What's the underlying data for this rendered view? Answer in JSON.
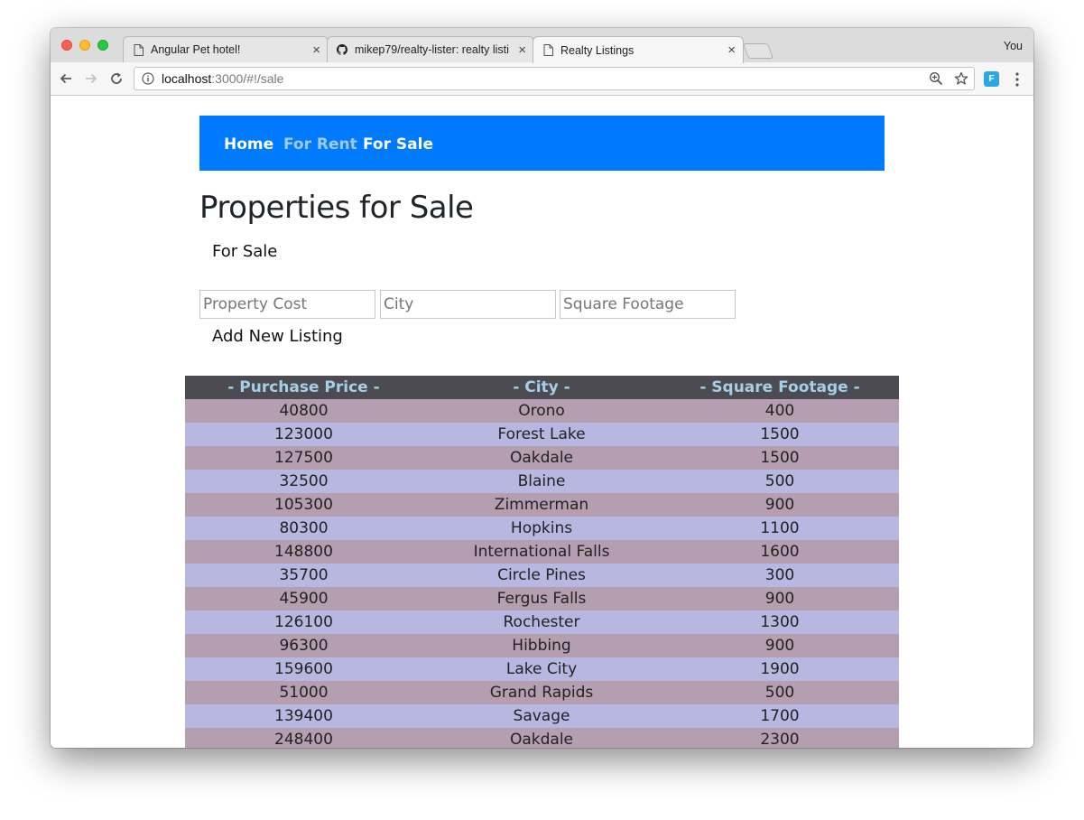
{
  "browser": {
    "tabs": [
      {
        "title": "Angular Pet hotel!",
        "icon": "document-icon"
      },
      {
        "title": "mikep79/realty-lister: realty listi",
        "icon": "github-icon"
      },
      {
        "title": "Realty Listings",
        "icon": "document-icon",
        "active": true
      }
    ],
    "profile": "You",
    "url_host": "localhost",
    "url_path": ":3000/#!/sale",
    "extension_label": "F"
  },
  "nav": {
    "home": "Home",
    "for_rent": "For Rent",
    "for_sale": "For Sale",
    "color": "#007bff"
  },
  "page": {
    "title": "Properties for Sale",
    "subtitle": "For Sale"
  },
  "form": {
    "cost_placeholder": "Property Cost",
    "city_placeholder": "City",
    "sqft_placeholder": "Square Footage",
    "add_label": "Add New Listing"
  },
  "table": {
    "headers": [
      "- Purchase Price -",
      "- City -",
      "- Square Footage -"
    ],
    "rows": [
      [
        "40800",
        "Orono",
        "400"
      ],
      [
        "123000",
        "Forest Lake",
        "1500"
      ],
      [
        "127500",
        "Oakdale",
        "1500"
      ],
      [
        "32500",
        "Blaine",
        "500"
      ],
      [
        "105300",
        "Zimmerman",
        "900"
      ],
      [
        "80300",
        "Hopkins",
        "1100"
      ],
      [
        "148800",
        "International Falls",
        "1600"
      ],
      [
        "35700",
        "Circle Pines",
        "300"
      ],
      [
        "45900",
        "Fergus Falls",
        "900"
      ],
      [
        "126100",
        "Rochester",
        "1300"
      ],
      [
        "96300",
        "Hibbing",
        "900"
      ],
      [
        "159600",
        "Lake City",
        "1900"
      ],
      [
        "51000",
        "Grand Rapids",
        "500"
      ],
      [
        "139400",
        "Savage",
        "1700"
      ],
      [
        "248400",
        "Oakdale",
        "2300"
      ]
    ],
    "header_bg": "#4d4b52",
    "row_color_odd": "#b69eb1",
    "row_color_even": "#b7b7e2"
  }
}
